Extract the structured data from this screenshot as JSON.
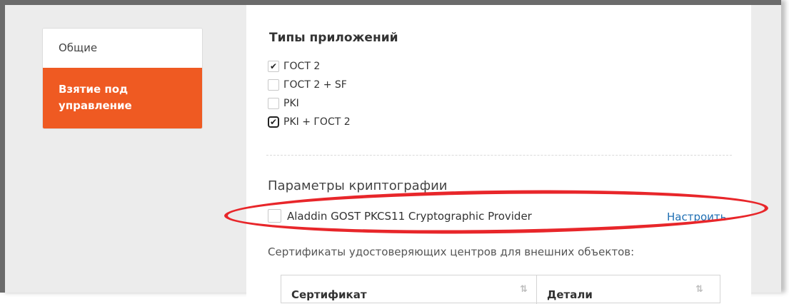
{
  "sidebar": {
    "items": [
      {
        "label": "Общие"
      },
      {
        "label": "Взятие под управление"
      }
    ]
  },
  "app_types": {
    "title": "Типы приложений",
    "options": [
      {
        "label": "ГОСТ 2",
        "checked": true
      },
      {
        "label": "ГОСТ 2 + SF",
        "checked": false
      },
      {
        "label": "PKI",
        "checked": false
      },
      {
        "label": "PKI + ГОСТ 2",
        "checked": true
      }
    ]
  },
  "crypto": {
    "title": "Параметры криптографии",
    "provider_label": "Aladdin GOST PKCS11 Cryptographic Provider",
    "provider_checked": false,
    "configure_link": "Настроить"
  },
  "certificates": {
    "caption": "Сертификаты удостоверяющих центров для внешних объектов:",
    "columns": [
      "Сертификат",
      "Детали"
    ]
  },
  "colors": {
    "accent": "#ef5a22",
    "link": "#1f6fb3",
    "annotation": "#e8262a"
  },
  "icons": {
    "check": "check-icon",
    "sort": "sort-icon"
  }
}
